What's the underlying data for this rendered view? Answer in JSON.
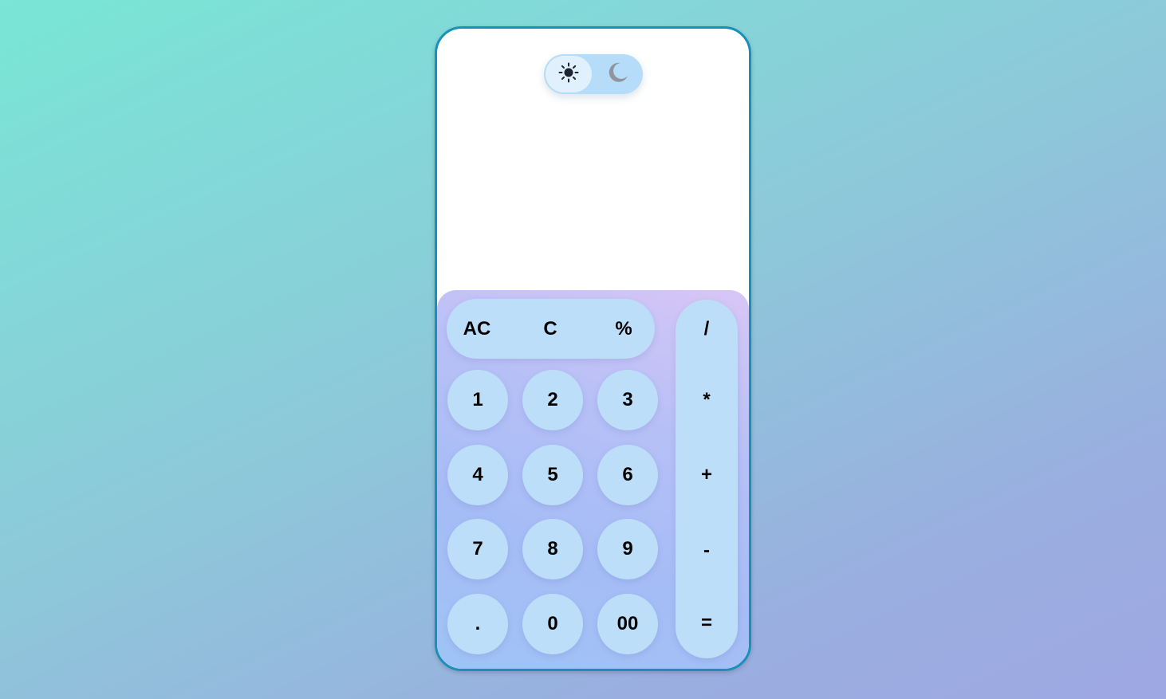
{
  "theme": {
    "light_icon": "sun-icon",
    "dark_icon": "moon-icon",
    "selected": "light"
  },
  "display": {
    "expression": "",
    "result": ""
  },
  "keys": {
    "top": [
      "AC",
      "C",
      "%"
    ],
    "digits": [
      [
        "1",
        "2",
        "3"
      ],
      [
        "4",
        "5",
        "6"
      ],
      [
        "7",
        "8",
        "9"
      ],
      [
        ".",
        "0",
        "00"
      ]
    ],
    "operators": [
      "/",
      "*",
      "+",
      "-",
      "="
    ]
  },
  "colors": {
    "key_bg": "#bddef8",
    "frame_border": "#1a8fb8",
    "toggle_bg": "#b5dcf8"
  }
}
